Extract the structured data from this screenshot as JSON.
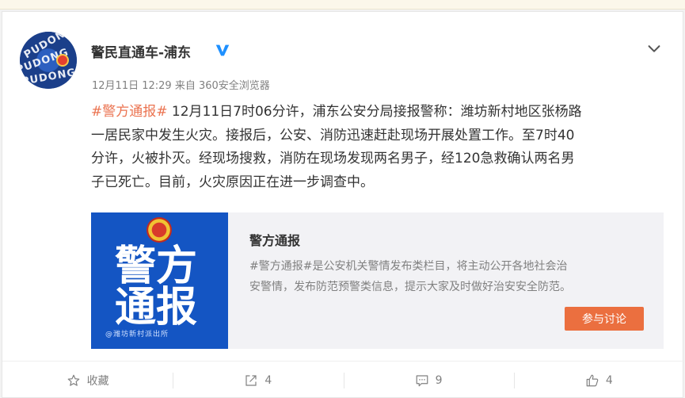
{
  "post": {
    "author": "警民直通车-浦东",
    "time": "12月11日 12:29",
    "source": "来自 360安全浏览器",
    "hashtag": "#警方通报#",
    "lines": [
      "12月11日7时06分许，浦东公安分局接报警称：潍坊新村地区张杨路",
      "一居民家中发生火灾。接报后，公安、消防迅速赶赴现场开展处置工作。至7时40",
      "分许，火被扑灭。经现场搜救，消防在现场发现两名男子，经120急救确认两名男",
      "子已死亡。目前，火灾原因正在进一步调查中。"
    ]
  },
  "avatar": {
    "text": "PUDONG"
  },
  "link_card": {
    "thumb_line1": "警方",
    "thumb_line2": "通报",
    "thumb_footer": "@潍坊新村派出所",
    "title": "警方通报",
    "desc_line1": "#警方通报#是公安机关警情发布类栏目，将主动公开各地社会治",
    "desc_line2": "安警情，发布防范预警类信息，提示大家及时做好治安安全防范。",
    "button": "参与讨论"
  },
  "actions": {
    "favorite": "收藏",
    "repost": "4",
    "comment": "9",
    "like": "4"
  },
  "colors": {
    "accent": "#eb7350",
    "button": "#eb6f3f",
    "verified": "#1e90ff",
    "thumb": "#1455c3"
  },
  "icons": [
    "verified-icon",
    "chevron-down-icon",
    "star-icon",
    "repost-icon",
    "comment-icon",
    "thumbs-up-icon"
  ]
}
